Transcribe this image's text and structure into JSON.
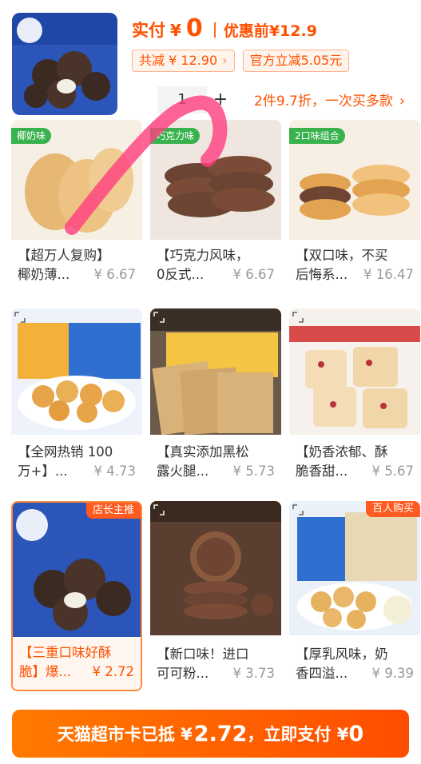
{
  "summary": {
    "actual_label": "实付",
    "currency": "¥",
    "actual_price": "0",
    "original_label": "优惠前",
    "original_price": "¥12.9",
    "total_saving": "共减 ¥ 12.90",
    "official_discount": "官方立减5.05元",
    "quantity": "1",
    "promo_text": "2件9.7折，一次买多款"
  },
  "products": [
    {
      "title1": "【超万人复购】",
      "title2": "椰奶薄...",
      "price": "¥ 6.67",
      "tag": "椰奶味",
      "badge": ""
    },
    {
      "title1": "【巧克力风味，",
      "title2": "0反式...",
      "price": "¥ 6.67",
      "tag": "巧克力味",
      "badge": ""
    },
    {
      "title1": "【双口味，不买",
      "title2": "后悔系...",
      "price": "¥ 16.47",
      "tag": "2口味组合",
      "badge": ""
    },
    {
      "title1": "【全网热销 100",
      "title2": "万+】...",
      "price": "¥ 4.73",
      "tag": "",
      "badge": ""
    },
    {
      "title1": "【真实添加黑松",
      "title2": "露火腿...",
      "price": "¥ 5.73",
      "tag": "",
      "badge": ""
    },
    {
      "title1": "【奶香浓郁、酥",
      "title2": "脆香甜...",
      "price": "¥ 5.67",
      "tag": "",
      "badge": ""
    },
    {
      "title1": "【三重口味好酥",
      "title2": "脆】爆...",
      "price": "¥ 2.72",
      "tag": "",
      "badge": "店长主推"
    },
    {
      "title1": "【新口味！进口",
      "title2": "可可粉...",
      "price": "¥ 3.73",
      "tag": "",
      "badge": ""
    },
    {
      "title1": "【厚乳风味，奶",
      "title2": "香四溢...",
      "price": "¥ 9.39",
      "tag": "",
      "badge": "百人购买"
    }
  ],
  "paybar": {
    "prefix": "天猫超市卡已抵 ¥",
    "amount": "2.72",
    "middle": "，立即支付 ¥",
    "final": "0"
  },
  "colors": {
    "accent": "#ff5000",
    "badge": "#ff5a1f",
    "selected_border": "#ff8a3d"
  },
  "icons": [
    "expand-icon",
    "chevron-right-icon",
    "plus-icon"
  ]
}
